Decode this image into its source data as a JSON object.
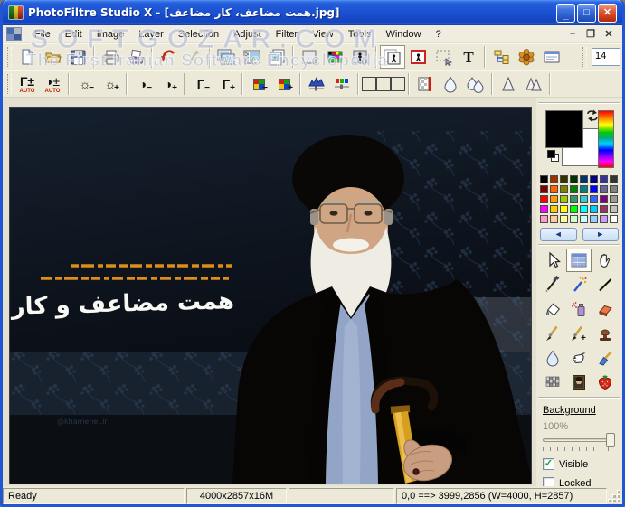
{
  "window": {
    "title": "PhotoFiltre Studio X - [همت مضاعف، کار مضاعف.jpg]",
    "minimize_glyph": "_",
    "maximize_glyph": "□",
    "close_glyph": "✕"
  },
  "mdi": {
    "minimize_glyph": "–",
    "restore_glyph": "❐",
    "close_glyph": "✕"
  },
  "watermark": {
    "line1": "SOFTGOZAR.COM",
    "line2": "The First Iranian Software Encyclopedia"
  },
  "menu": {
    "items": [
      "File",
      "Edit",
      "Image",
      "Layer",
      "Selection",
      "Adjust",
      "Filter",
      "View",
      "Tools",
      "Window",
      "?"
    ]
  },
  "toolbar_main": {
    "zoom_value": "14",
    "text_tool_glyph": "T",
    "icon_names": [
      "new-icon",
      "open-icon",
      "save-icon",
      "print-icon",
      "scan-icon",
      "undo-icon",
      "redo-icon",
      "photo-copy-icon",
      "photomask-icon",
      "duplicate-icon",
      "grayscale-icon",
      "rgb-mode-icon",
      "indexed-mode-icon",
      "layers-icon",
      "image-frame-icon",
      "paste-as-selection-icon",
      "text-icon",
      "explorer-icon",
      "plugins-icon",
      "preview-icon",
      "zoom-combo"
    ]
  },
  "toolbar_adjust": {
    "auto_label": "AUTO",
    "gamma_glyph": "Γ",
    "gamma_pm_glyph": "Γ±",
    "contrast_glyph": "◑",
    "contrast_pm_glyph": "◑±",
    "brightness_glyph": "☼",
    "plus": "+",
    "minus": "−",
    "icon_names": [
      "auto-gamma-icon",
      "auto-contrast-icon",
      "brightness-minus-icon",
      "brightness-plus-icon",
      "contrast-minus-icon",
      "contrast-plus-icon",
      "gamma-minus-icon",
      "gamma-plus-icon",
      "saturation-minus-icon",
      "saturation-plus-icon",
      "histogram-icon",
      "color-balance-icon",
      "photomask-gray-icon",
      "photomask-brown-icon",
      "photomask-olive-icon",
      "transparent-color-icon",
      "blur-icon",
      "blur-more-icon",
      "sharpen-icon",
      "sharpen-more-icon"
    ]
  },
  "canvas": {
    "slogan": "همت مضاعف و کار مضاعف",
    "watermark": "@khamenei.ir"
  },
  "right_panel": {
    "nav_prev_glyph": "◄",
    "nav_next_glyph": "►",
    "palette_rows": [
      [
        "#000000",
        "#993300",
        "#333300",
        "#003300",
        "#003366",
        "#000080",
        "#333399",
        "#333333"
      ],
      [
        "#800000",
        "#FF6600",
        "#808000",
        "#008000",
        "#008080",
        "#0000FF",
        "#666699",
        "#808080"
      ],
      [
        "#FF0000",
        "#FF9900",
        "#99CC00",
        "#339966",
        "#33CCCC",
        "#3366FF",
        "#800080",
        "#999999"
      ],
      [
        "#FF00FF",
        "#FFCC00",
        "#FFFF00",
        "#00FF00",
        "#00FFFF",
        "#00CCFF",
        "#993366",
        "#C0C0C0"
      ],
      [
        "#FF99CC",
        "#FFCC99",
        "#FFFF99",
        "#CCFFCC",
        "#CCFFFF",
        "#99CCFF",
        "#CC99FF",
        "#FFFFFF"
      ]
    ],
    "tool_names": [
      "selection-arrow-tool",
      "layer-manager-tool",
      "hand-tool",
      "eyedropper-tool",
      "magic-wand-tool",
      "line-tool",
      "fill-tool",
      "airbrush-tool",
      "eraser-tool",
      "brush-tool",
      "advanced-brush-tool",
      "clone-stamp-tool",
      "blur-tool",
      "smudge-tool",
      "retouch-tool",
      "deform-tool",
      "artistic-copy-tool",
      "nozzle-tool"
    ],
    "layer": {
      "name": "Background",
      "opacity": "100%",
      "visible_label": "Visible",
      "locked_label": "Locked"
    }
  },
  "status": {
    "ready": "Ready",
    "size": "4000x2857x16M",
    "coords": "0,0 ==> 3999,2856 (W=4000, H=2857)"
  },
  "colors": {
    "titlebar_blue": "#2156D2",
    "panel_bg": "#ECE9D8",
    "close_red": "#CC3A14",
    "slogan_orange": "#E8941A"
  }
}
